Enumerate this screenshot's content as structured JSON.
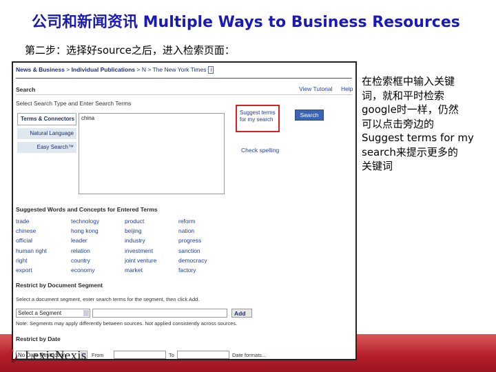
{
  "slide": {
    "title": "公司和新闻资讯 Multiple Ways to Business Resources",
    "step": "第二步：选择好source之后，进入检索页面：",
    "note_lines": [
      "在检索框中输入关键",
      "词，就和平时检索",
      "google时一样，仍然",
      "可以点击旁边的",
      "Suggest terms for my",
      "search来提示更多的",
      "关键词"
    ],
    "logo_text": "LexisNexis",
    "brand_color": "#b51f2b",
    "title_color": "#1a1ab4"
  },
  "screenshot": {
    "breadcrumb": {
      "part1": "News & Business",
      "sep": " > ",
      "part2": "Individual Publications",
      "part3": " > N > ",
      "part4": "The New York Times",
      "page": "i"
    },
    "section_search": "Search",
    "view_tutorial": "View Tutorial",
    "help": "Help",
    "select_type_label": "Select Search Type and Enter Search Terms",
    "tabs": [
      "Terms & Connectors",
      "Natural Language",
      "Easy Search™"
    ],
    "textarea_value": "china",
    "suggest_terms": "Suggest terms for my search",
    "search_button": "Search",
    "check_spelling": "Check spelling",
    "suggested_heading": "Suggested Words and Concepts for Entered Terms",
    "suggested_columns": [
      [
        "trade",
        "chinese",
        "official",
        "human right",
        "right",
        "export"
      ],
      [
        "technology",
        "hong kong",
        "leader",
        "relation",
        "country",
        "economy"
      ],
      [
        "product",
        "beijing",
        "industry",
        "investment",
        "joint venture",
        "market"
      ],
      [
        "reform",
        "nation",
        "progress",
        "sanction",
        "democracy",
        "factory"
      ]
    ],
    "restrict_segment": "Restrict by Document Segment",
    "segment_instruction": "Select a document segment, enter search terms for the segment, then click Add.",
    "segment_select": "Select a Segment",
    "add_button": "Add",
    "segment_note": "Note: Segments may apply differently between sources. Not applied consistently across sources.",
    "restrict_date": "Restrict by Date",
    "date_select": "No Date Restriction",
    "from_label": "From",
    "to_label": "To",
    "date_formats": "Date formats..."
  }
}
